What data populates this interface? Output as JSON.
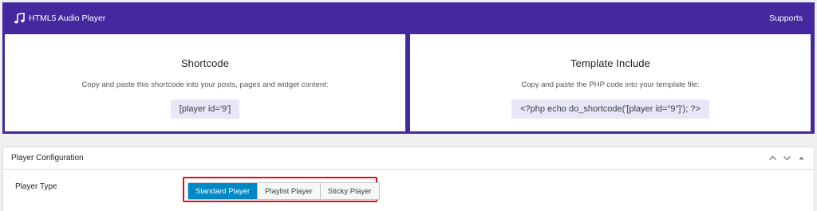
{
  "header": {
    "app_title": "HTML5 Audio Player",
    "app_icon": "music-note-icon",
    "supports_label": "Supports"
  },
  "shortcode_card": {
    "title": "Shortcode",
    "description": "Copy and paste this shortcode into your posts, pages and widget content:",
    "code": "[player id='9']"
  },
  "template_card": {
    "title": "Template Include",
    "description": "Copy and paste the PHP code into your template file:",
    "code": "<?php echo do_shortcode('[player id=\"9\"]'); ?>"
  },
  "config": {
    "title": "Player Configuration",
    "controls": [
      "chevron-up-icon",
      "chevron-down-icon",
      "triangle-up-icon"
    ],
    "player_type_label": "Player Type",
    "options": [
      {
        "label": "Standard Player",
        "active": true
      },
      {
        "label": "Playlist Player",
        "active": false
      },
      {
        "label": "Sticky Player",
        "active": false
      }
    ]
  },
  "colors": {
    "brand_purple": "#4527a0",
    "active_blue": "#0088c6",
    "code_bg": "#e9e6f7",
    "highlight_red": "#e0101a"
  }
}
